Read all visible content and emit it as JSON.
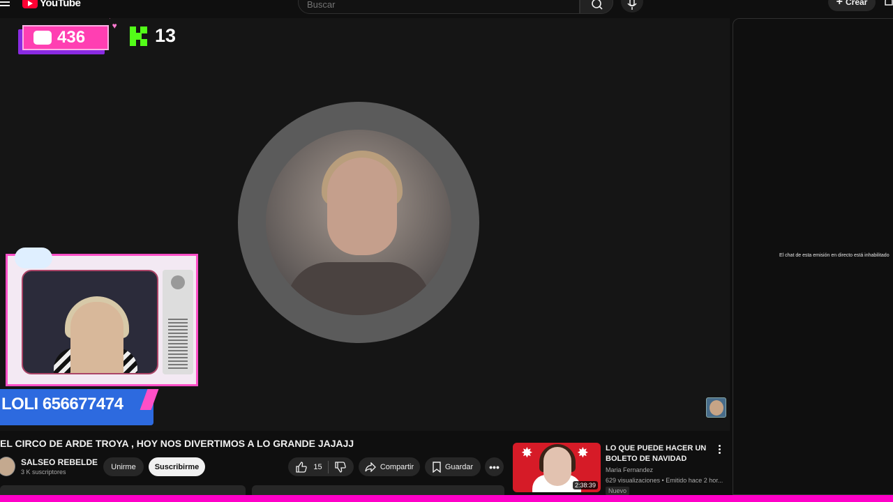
{
  "header": {
    "logo_text": "YouTube",
    "search_placeholder": "Buscar",
    "create_label": "Crear"
  },
  "overlay": {
    "chat_count": "436",
    "kick_count": "13",
    "name_banner": "LOLI 656677474"
  },
  "chat": {
    "disabled_message": "El chat de esta emisión en directo está inhabilitado"
  },
  "video": {
    "title": "EL CIRCO DE ARDE TROYA , HOY NOS DIVERTIMOS A LO GRANDE JAJAJJ",
    "channel_name": "SALSEO REBELDE",
    "subscribers": "3 K suscriptores",
    "join_label": "Unirme",
    "subscribe_label": "Suscribirme",
    "likes": "15",
    "share_label": "Compartir",
    "save_label": "Guardar"
  },
  "recommendation": {
    "title": "LO QUE PUEDE HACER UN BOLETO DE NAVIDAD",
    "channel": "Maria Fernandez",
    "meta": "629 visualizaciones • Emitido hace 2 hor...",
    "badge": "Nuevo",
    "duration": "2:38:39"
  },
  "colors": {
    "accent_pink": "#ff3fb2",
    "kick_green": "#53fc18",
    "youtube_red": "#ff0033",
    "banner_blue": "#2d6adf"
  }
}
